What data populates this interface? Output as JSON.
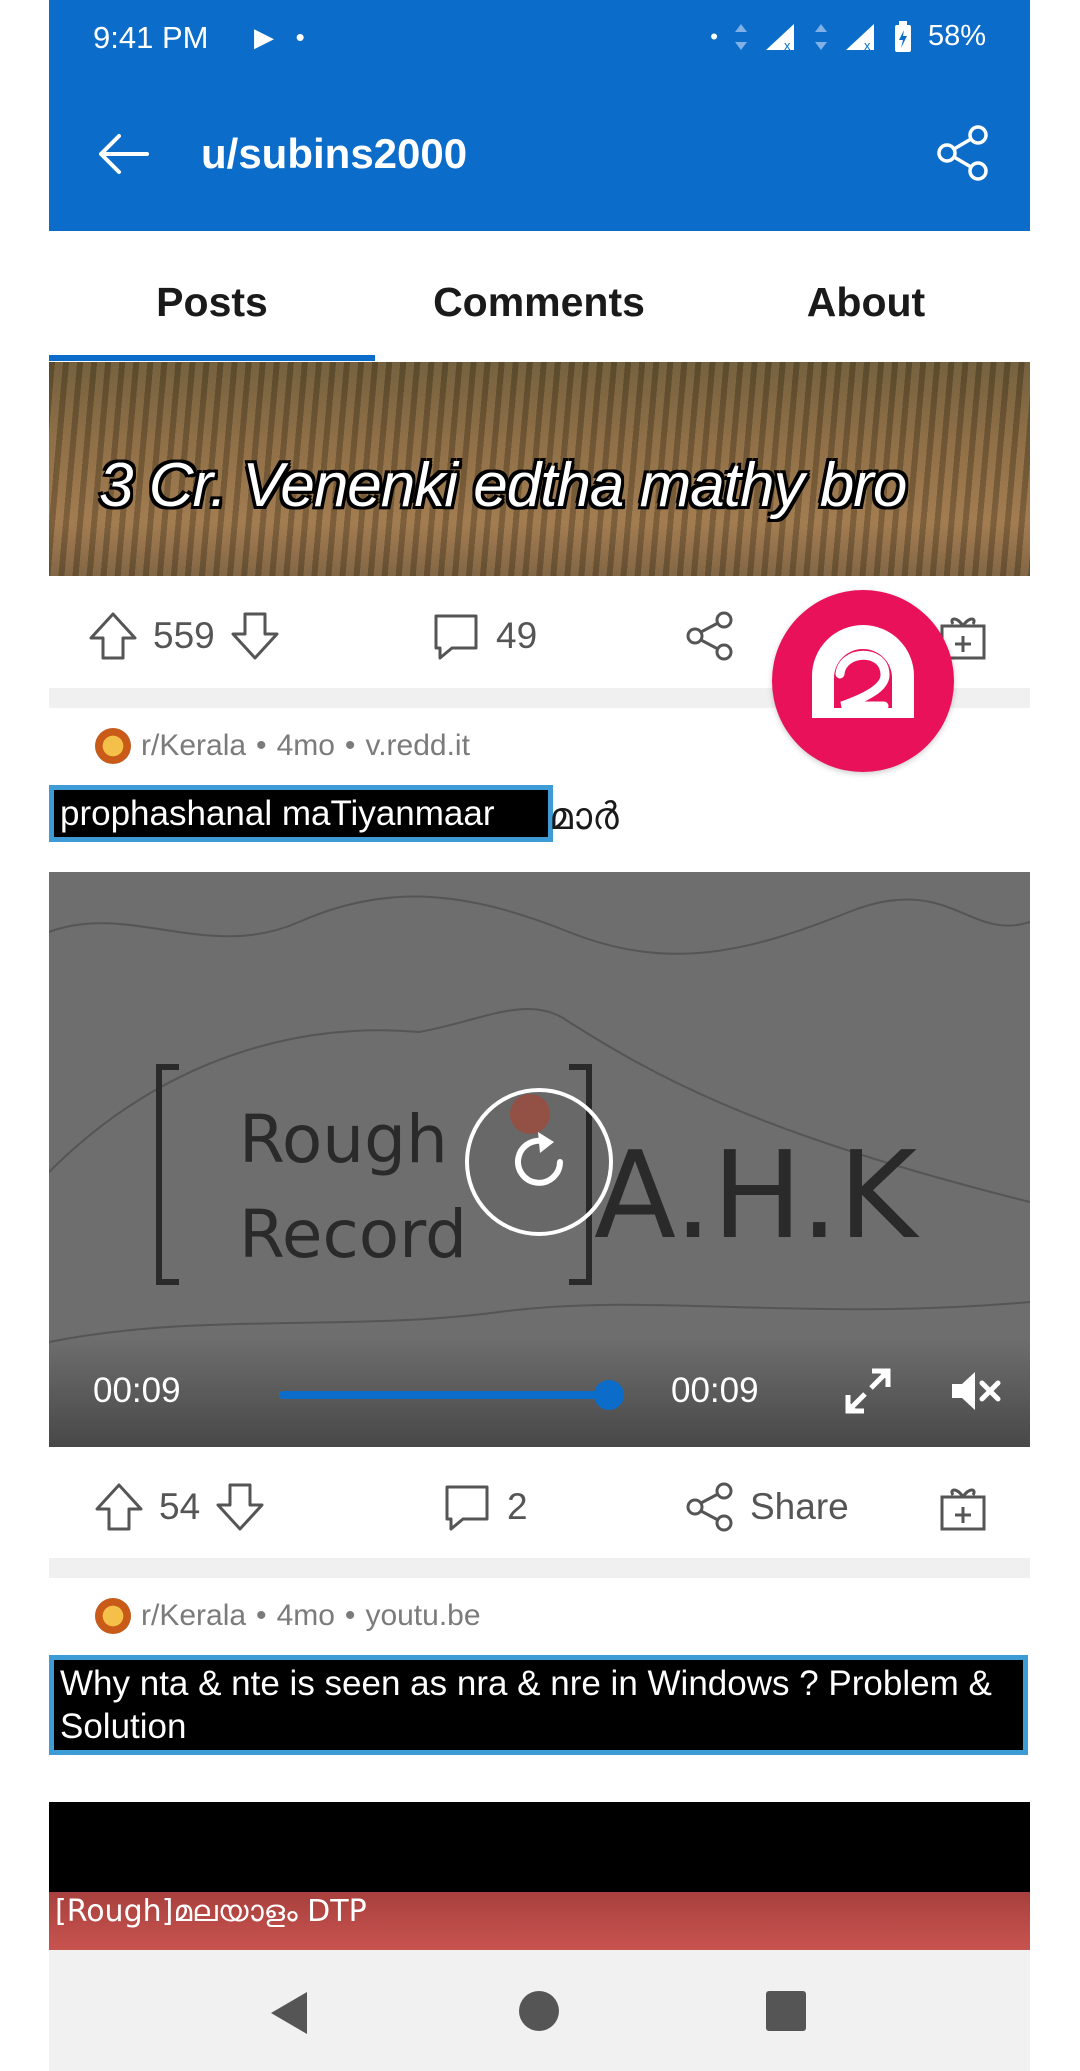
{
  "status_bar": {
    "time": "9:41 PM",
    "battery": "58%"
  },
  "app_bar": {
    "title": "u/subins2000"
  },
  "tabs": [
    {
      "label": "Posts",
      "active": true
    },
    {
      "label": "Comments",
      "active": false
    },
    {
      "label": "About",
      "active": false
    }
  ],
  "post1": {
    "thumbnail_caption": "3 Cr. Venenki edtha mathy bro",
    "upvotes": "559",
    "comments": "49"
  },
  "post2": {
    "subreddit": "r/Kerala",
    "age": "4mo",
    "domain": "v.redd.it",
    "title_highlight": "prophashanal maTiyanmaar",
    "title_rest": "മാർ",
    "video": {
      "watermark_line1": "Rough",
      "watermark_line2": "Record",
      "watermark_mark": "A.H.K",
      "elapsed": "00:09",
      "duration": "00:09",
      "progress": 1.0
    },
    "upvotes": "54",
    "comments": "2",
    "share_label": "Share"
  },
  "post3": {
    "subreddit": "r/Kerala",
    "age": "4mo",
    "domain": "youtu.be",
    "title": "Why nta & nte is seen as nra & nre in Windows ? Problem & Solution",
    "thumbnail_text": "[Rough]മലയാളം DTP"
  },
  "colors": {
    "brand_blue": "#0b6cc9",
    "badge_pink": "#e8115a",
    "highlight_border": "#3d9cd6"
  }
}
